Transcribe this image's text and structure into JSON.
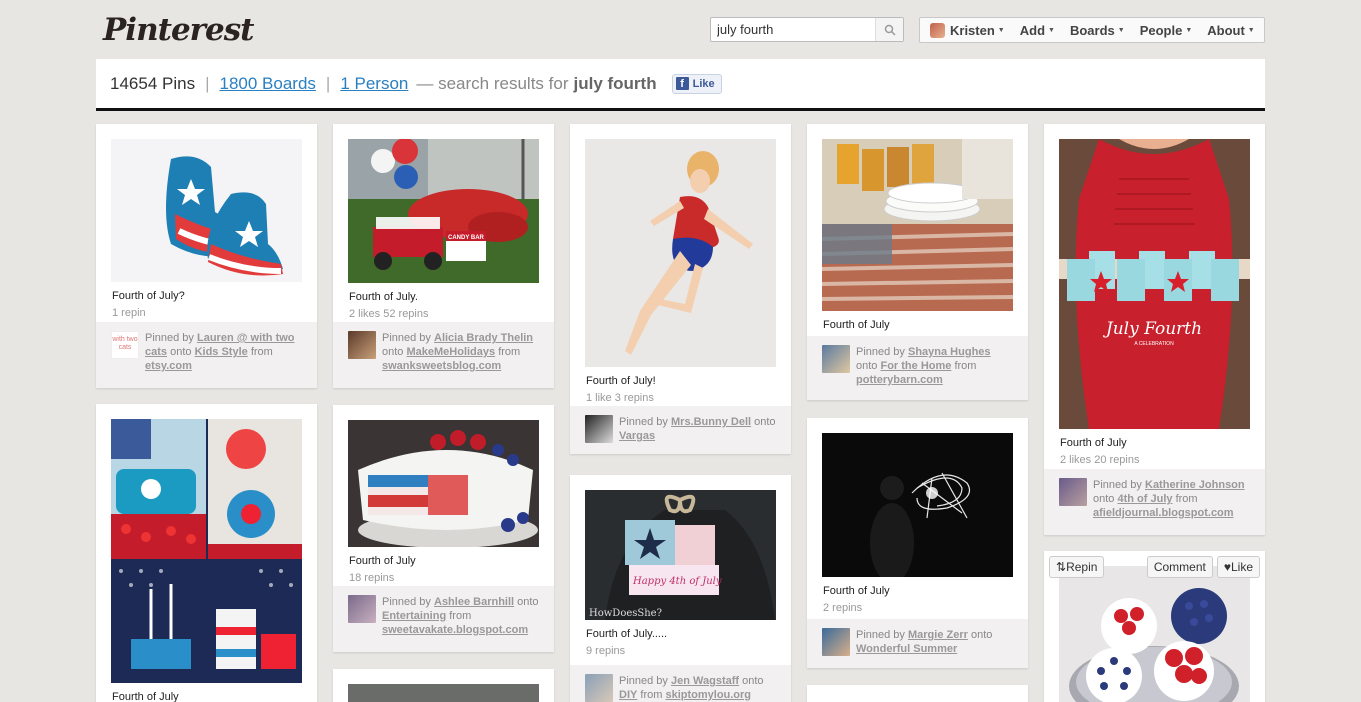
{
  "header": {
    "logo": "Pinterest",
    "search": {
      "value": "july fourth",
      "placeholder": "Search"
    },
    "nav": [
      {
        "label": "Kristen"
      },
      {
        "label": "Add"
      },
      {
        "label": "Boards"
      },
      {
        "label": "People"
      },
      {
        "label": "About"
      }
    ]
  },
  "results": {
    "pins_count": "14654 Pins",
    "boards_link": "1800 Boards",
    "person_link": "1 Person",
    "text": "— search results for",
    "query": "july fourth",
    "fb_like": "Like"
  },
  "pins": [
    {
      "desc": "Fourth of July?",
      "stats": "1 repin",
      "pinned_by": "Lauren @ with two cats",
      "onto": "Kids Style",
      "from": "etsy.com"
    },
    {
      "desc": "Fourth of July",
      "stats": "",
      "pinned_by": "",
      "onto": "",
      "from": ""
    },
    {
      "desc": "Fourth of July.",
      "stats": "2 likes  52 repins",
      "pinned_by": "Alicia Brady Thelin",
      "onto": "MakeMeHolidays",
      "from": "swanksweetsblog.com"
    },
    {
      "desc": "Fourth of July",
      "stats": "18 repins",
      "pinned_by": "Ashlee Barnhill",
      "onto": "Entertaining",
      "from": "sweetavakate.blogspot.com"
    },
    {
      "desc": "Fourth of July!",
      "stats": "1 like  3 repins",
      "pinned_by": "Mrs.Bunny Dell",
      "onto": "Vargas",
      "from": ""
    },
    {
      "desc": "Fourth of July.....",
      "stats": "9 repins",
      "pinned_by": "Jen Wagstaff",
      "onto": "DIY",
      "from": "skiptomylou.org"
    },
    {
      "desc": "Fourth of July",
      "stats": "",
      "pinned_by": "Shayna Hughes",
      "onto": "For the Home",
      "from": "potterybarn.com"
    },
    {
      "desc": "Fourth of July",
      "stats": "2 repins",
      "pinned_by": "Margie Zerr",
      "onto": "Wonderful Summer",
      "from": ""
    },
    {
      "desc": "Fourth of July",
      "stats": "2 likes  20 repins",
      "pinned_by": "Katherine Johnson",
      "onto": "4th of July",
      "from": "afieldjournal.blogspot.com"
    }
  ],
  "labels": {
    "pinned_by": "Pinned by",
    "onto": "onto",
    "from": "from"
  },
  "image_text": {
    "candy_bar": "CANDY BAR",
    "happy_4th": "Happy 4th of July",
    "howdoesshe": "HowDoesShe?",
    "july_fourth_script": "July Fourth",
    "a_celebration": "A CELEBRATION",
    "with_two_cats": "with two cats"
  },
  "hover_actions": {
    "repin": "Repin",
    "comment": "Comment",
    "like": "Like"
  },
  "colors": {
    "link": "#2a7fc0",
    "attribution_bg": "#f2f0f0",
    "page_bg": "#e8e6e3"
  }
}
